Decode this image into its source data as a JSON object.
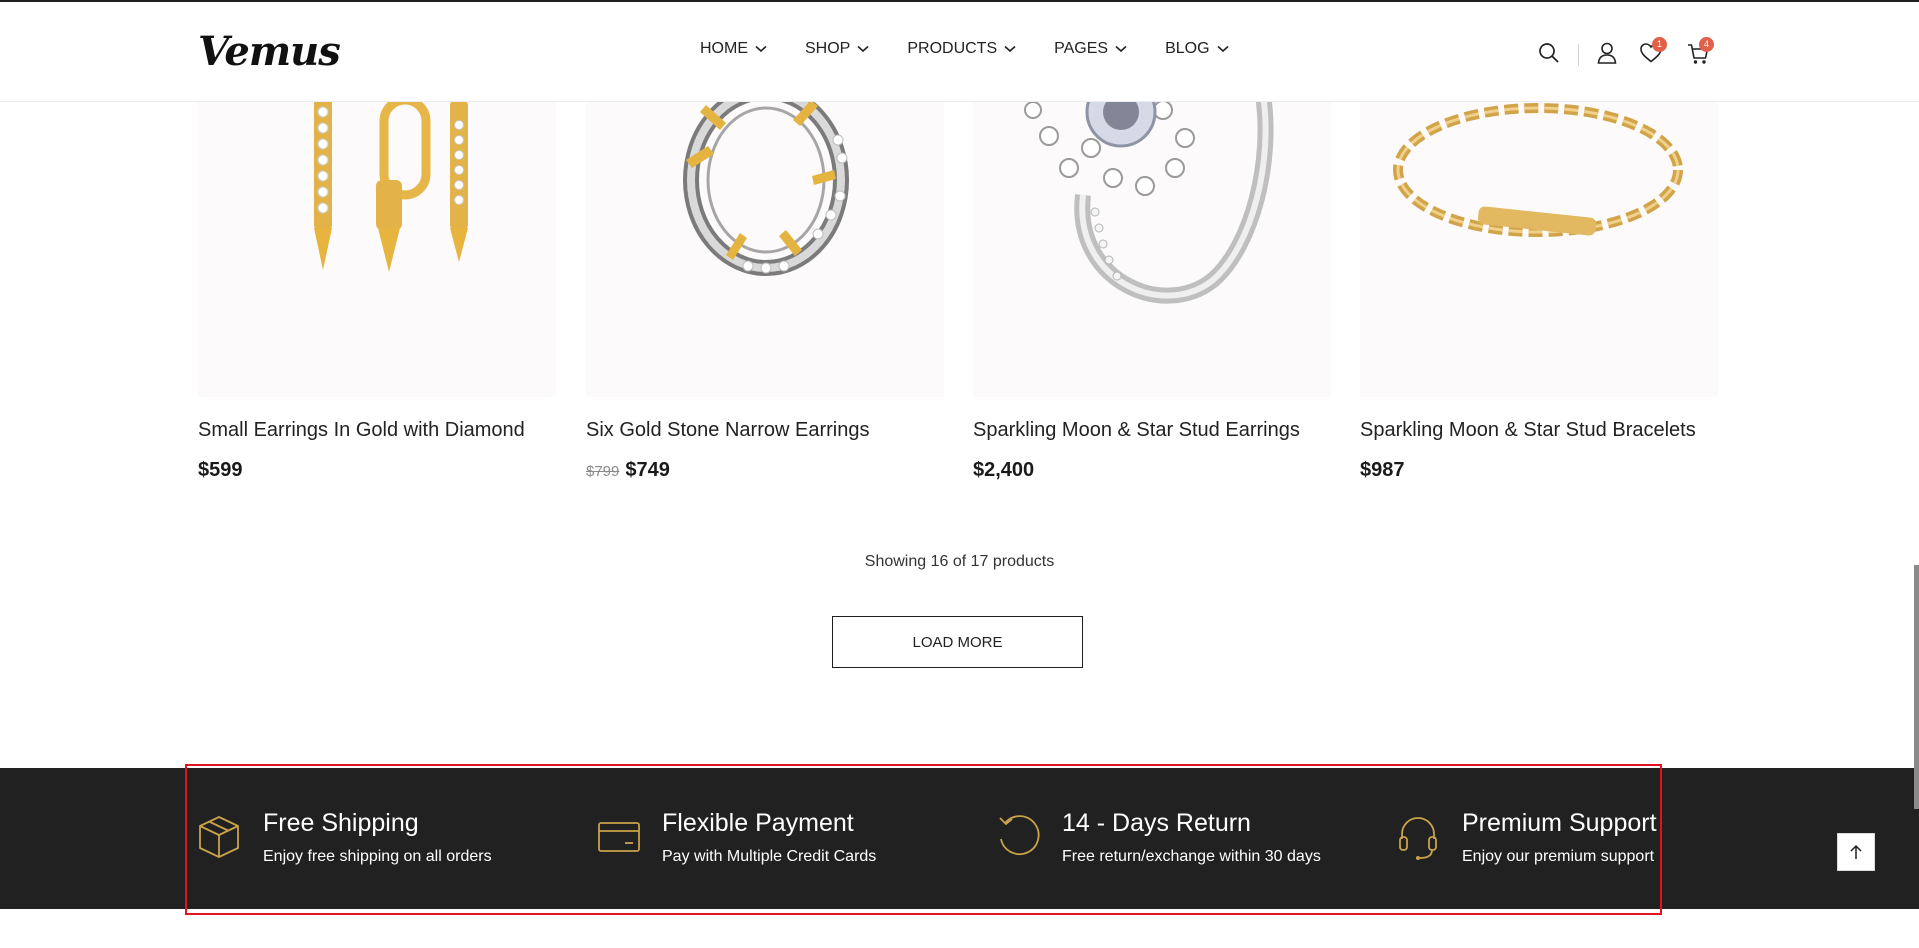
{
  "header": {
    "logo": "Vemus",
    "nav": [
      {
        "label": "HOME"
      },
      {
        "label": "SHOP"
      },
      {
        "label": "PRODUCTS"
      },
      {
        "label": "PAGES"
      },
      {
        "label": "BLOG"
      }
    ],
    "wishlist_count": "1",
    "cart_count": "4",
    "icons": [
      "search-icon",
      "user-icon",
      "heart-icon",
      "cart-icon",
      "chevron-down-icon"
    ]
  },
  "products": [
    {
      "name": "Small Earrings In Gold with Diamond",
      "old_price": "",
      "price": "$599"
    },
    {
      "name": "Six Gold Stone Narrow Earrings",
      "old_price": "$799",
      "price": "$749"
    },
    {
      "name": "Sparkling Moon & Star Stud Earrings",
      "old_price": "",
      "price": "$2,400"
    },
    {
      "name": "Sparkling Moon & Star Stud Bracelets",
      "old_price": "",
      "price": "$987"
    }
  ],
  "listing": {
    "showing_text": "Showing 16 of 17 products",
    "load_more_label": "LOAD MORE"
  },
  "features": [
    {
      "icon": "box-icon",
      "title": "Free Shipping",
      "subtitle": "Enjoy free shipping on all orders"
    },
    {
      "icon": "credit-card-icon",
      "title": "Flexible Payment",
      "subtitle": "Pay with Multiple Credit Cards"
    },
    {
      "icon": "return-icon",
      "title": "14 - Days Return",
      "subtitle": "Free return/exchange within 30 days"
    },
    {
      "icon": "headset-icon",
      "title": "Premium Support",
      "subtitle": "Enjoy our premium support"
    }
  ],
  "colors": {
    "accent_gold": "#c9a24a",
    "badge": "#e0604a",
    "dark_band": "#212121",
    "highlight_border": "#e0141e"
  }
}
